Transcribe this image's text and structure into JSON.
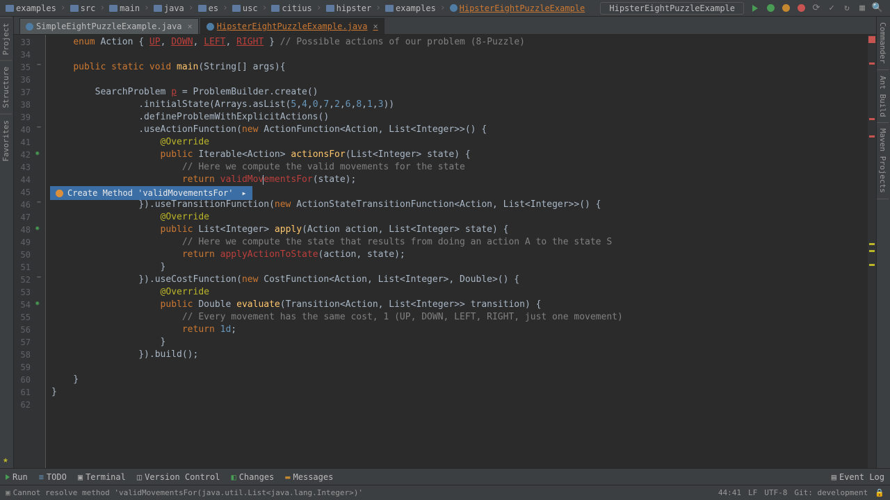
{
  "nav": {
    "items": [
      {
        "label": "examples",
        "icon": "folder"
      },
      {
        "label": "src",
        "icon": "folder"
      },
      {
        "label": "main",
        "icon": "folder"
      },
      {
        "label": "java",
        "icon": "folder"
      },
      {
        "label": "es",
        "icon": "folder"
      },
      {
        "label": "usc",
        "icon": "folder"
      },
      {
        "label": "citius",
        "icon": "folder"
      },
      {
        "label": "hipster",
        "icon": "folder"
      },
      {
        "label": "examples",
        "icon": "folder"
      },
      {
        "label": "HipsterEightPuzzleExample",
        "icon": "java",
        "highlight": true
      }
    ],
    "run_config": "HipsterEightPuzzleExample"
  },
  "tabs": [
    {
      "label": "SimpleEightPuzzleExample.java",
      "active": false
    },
    {
      "label": "HipsterEightPuzzleExample.java",
      "active": true,
      "modified": true
    }
  ],
  "left_tools": [
    "Project",
    "Structure",
    "Favorites"
  ],
  "right_tools": [
    "Commander",
    "Ant Build",
    "Maven Projects"
  ],
  "line_start": 33,
  "line_end": 62,
  "code_lines": [
    {
      "n": 33,
      "html": "    <span class='kw'>enum</span> Action { <span class='err underline'>UP</span>, <span class='err underline'>DOWN</span>, <span class='err underline'>LEFT</span>, <span class='err underline'>RIGHT</span> } <span class='comment'>// Possible actions of our problem (8-Puzzle)</span>"
    },
    {
      "n": 34,
      "html": ""
    },
    {
      "n": 35,
      "html": "    <span class='kw'>public static void</span> <span class='method'>main</span>(String[] args){",
      "fold": true
    },
    {
      "n": 36,
      "html": ""
    },
    {
      "n": 37,
      "html": "        SearchProblem <span class='err underline'>p</span> = ProblemBuilder.create()"
    },
    {
      "n": 38,
      "html": "                .initialState(Arrays.asList(<span class='num'>5</span>,<span class='num'>4</span>,<span class='num'>0</span>,<span class='num'>7</span>,<span class='num'>2</span>,<span class='num'>6</span>,<span class='num'>8</span>,<span class='num'>1</span>,<span class='num'>3</span>))"
    },
    {
      "n": 39,
      "html": "                .defineProblemWithExplicitActions()"
    },
    {
      "n": 40,
      "html": "                .useActionFunction(<span class='kw'>new</span> ActionFunction&lt;Action, List&lt;Integer&gt;&gt;() {",
      "fold": true
    },
    {
      "n": 41,
      "html": "                    <span class='ann'>@Override</span>"
    },
    {
      "n": 42,
      "html": "                    <span class='kw'>public</span> Iterable&lt;Action&gt; <span class='method'>actionsFor</span>(List&lt;Integer&gt; state) {",
      "impl": true
    },
    {
      "n": 43,
      "html": "                        <span class='comment'>// Here we compute the valid movements for the state</span>"
    },
    {
      "n": 44,
      "html": "                        <span class='kw'>return</span> <span class='err'>validMov<span class='caret'></span>ementsFor</span>(state);"
    },
    {
      "n": 45,
      "html": "                    }",
      "intention": true
    },
    {
      "n": 46,
      "html": "                }).useTransitionFunction(<span class='kw'>new</span> ActionStateTransitionFunction&lt;Action, List&lt;Integer&gt;&gt;() {",
      "fold": true
    },
    {
      "n": 47,
      "html": "                    <span class='ann'>@Override</span>"
    },
    {
      "n": 48,
      "html": "                    <span class='kw'>public</span> List&lt;Integer&gt; <span class='method'>apply</span>(Action action, List&lt;Integer&gt; state) {",
      "impl": true
    },
    {
      "n": 49,
      "html": "                        <span class='comment'>// Here we compute the state that results from doing an action A to the state S</span>"
    },
    {
      "n": 50,
      "html": "                        <span class='kw'>return</span> <span class='err'>applyActionToState</span>(action, state);"
    },
    {
      "n": 51,
      "html": "                    }"
    },
    {
      "n": 52,
      "html": "                }).useCostFunction(<span class='kw'>new</span> CostFunction&lt;Action, List&lt;Integer&gt;, Double&gt;() {",
      "fold": true
    },
    {
      "n": 53,
      "html": "                    <span class='ann'>@Override</span>"
    },
    {
      "n": 54,
      "html": "                    <span class='kw'>public</span> Double <span class='method'>evaluate</span>(Transition&lt;Action, List&lt;Integer&gt;&gt; transition) {",
      "impl": true
    },
    {
      "n": 55,
      "html": "                        <span class='comment'>// Every movement has the same cost, 1 (UP, DOWN, LEFT, RIGHT, just one movement)</span>"
    },
    {
      "n": 56,
      "html": "                        <span class='kw'>return</span> <span class='num'>1d</span>;"
    },
    {
      "n": 57,
      "html": "                    }"
    },
    {
      "n": 58,
      "html": "                }).build();"
    },
    {
      "n": 59,
      "html": ""
    },
    {
      "n": 60,
      "html": "    }"
    },
    {
      "n": 61,
      "html": "}"
    },
    {
      "n": 62,
      "html": ""
    }
  ],
  "intention_text": "Create Method 'validMovementsFor'",
  "bottom": {
    "run": "Run",
    "todo": "TODO",
    "terminal": "Terminal",
    "vcs": "Version Control",
    "changes": "Changes",
    "messages": "Messages",
    "eventlog": "Event Log"
  },
  "status": {
    "message": "Cannot resolve method 'validMovementsFor(java.util.List<java.lang.Integer>)'",
    "cursor": "44:41",
    "sep": "LF",
    "encoding": "UTF-8",
    "git": "Git: development"
  }
}
